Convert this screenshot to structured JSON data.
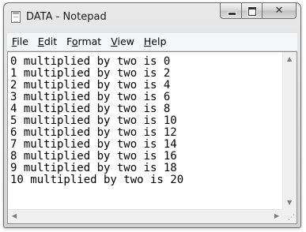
{
  "window": {
    "title": "DATA - Notepad"
  },
  "caption_buttons": {
    "close_glyph": "✕"
  },
  "menu": {
    "items": [
      {
        "mnemonic": "F",
        "rest": "ile"
      },
      {
        "mnemonic": "E",
        "rest": "dit"
      },
      {
        "pre": "F",
        "mnemonic": "o",
        "rest": "rmat"
      },
      {
        "mnemonic": "V",
        "rest": "iew"
      },
      {
        "mnemonic": "H",
        "rest": "elp"
      }
    ]
  },
  "editor": {
    "lines": [
      "0 multiplied by two is 0",
      "1 multiplied by two is 2",
      "2 multiplied by two is 4",
      "3 multiplied by two is 6",
      "4 multiplied by two is 8",
      "5 multiplied by two is 10",
      "6 multiplied by two is 12",
      "7 multiplied by two is 14",
      "8 multiplied by two is 16",
      "9 multiplied by two is 18",
      "10 multiplied by two is 20"
    ]
  },
  "scrollbars": {
    "up": "▲",
    "down": "▼",
    "left": "◀",
    "right": "▶",
    "grip": "⋰"
  },
  "icons": {
    "app": "notepad-icon",
    "minimize": "minimize-icon",
    "maximize": "maximize-icon",
    "close": "close-icon"
  }
}
